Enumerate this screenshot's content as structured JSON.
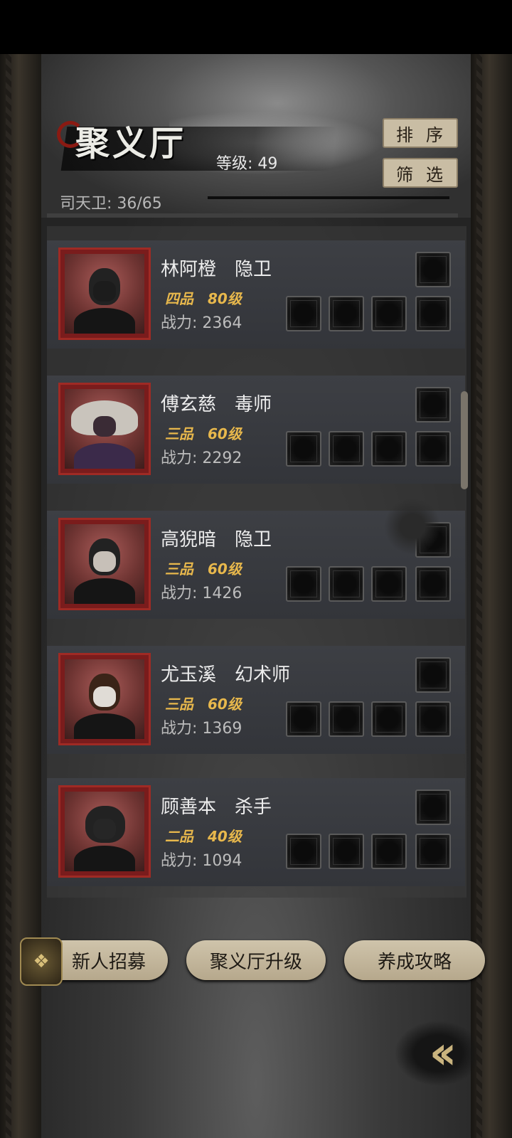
{
  "header": {
    "hall_title": "聚义厅",
    "level_label": "等级: 49",
    "guard_count": "司天卫: 36/65",
    "sort_button": "排序",
    "filter_button": "筛选"
  },
  "characters": [
    {
      "name": "林阿橙",
      "role": "隐卫",
      "rank": "四品",
      "level": "80级",
      "power": "战力: 2364"
    },
    {
      "name": "傅玄慈",
      "role": "毒师",
      "rank": "三品",
      "level": "60级",
      "power": "战力: 2292"
    },
    {
      "name": "高猊暗",
      "role": "隐卫",
      "rank": "三品",
      "level": "60级",
      "power": "战力: 1426"
    },
    {
      "name": "尤玉溪",
      "role": "幻术师",
      "rank": "三品",
      "level": "60级",
      "power": "战力: 1369"
    },
    {
      "name": "顾善本",
      "role": "杀手",
      "rank": "二品",
      "level": "40级",
      "power": "战力: 1094"
    }
  ],
  "footer": {
    "recruit_button": "新人招募",
    "upgrade_button": "聚义厅升级",
    "guide_button": "养成攻略"
  },
  "colors": {
    "grade_gold": "#e8b84c",
    "portrait_frame": "#9f2a24",
    "button_beige": "#c9bda4"
  }
}
